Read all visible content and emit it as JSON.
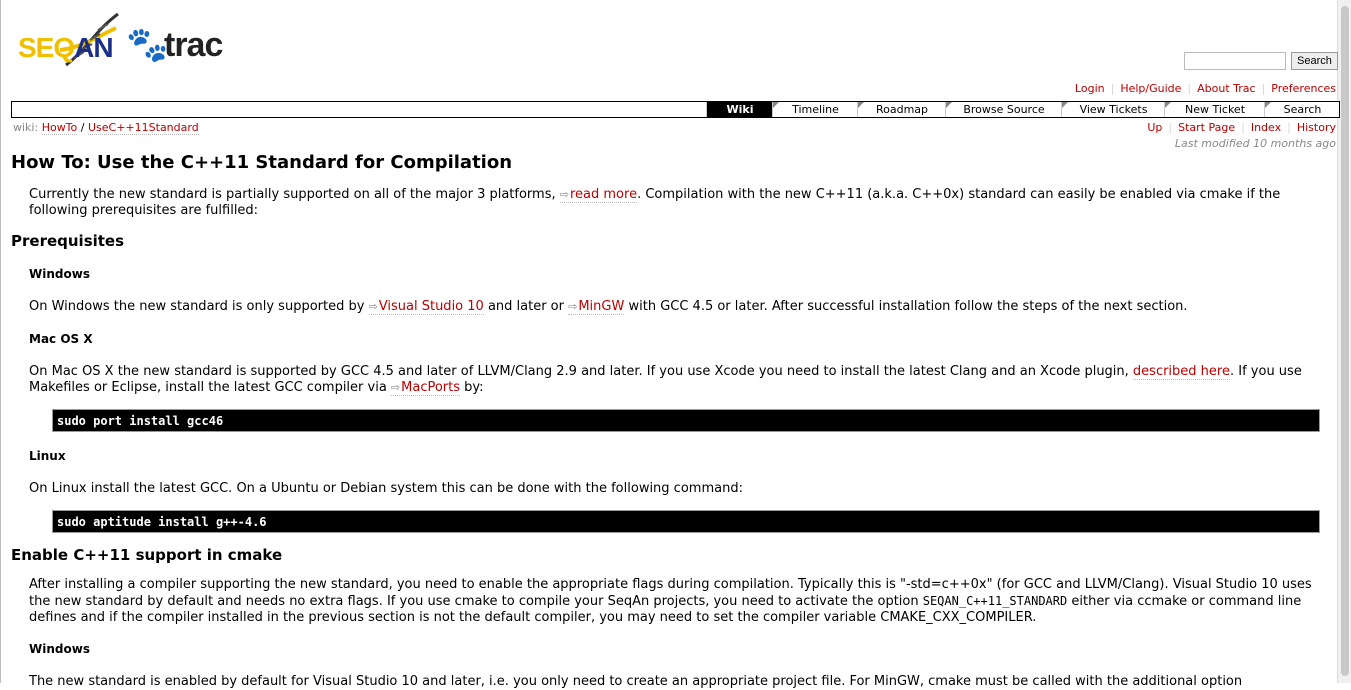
{
  "logo": {
    "seq": "SEQ",
    "an": "AN",
    "trac": "trac",
    "paw": "🐾"
  },
  "search": {
    "placeholder": "",
    "button_label": "Search"
  },
  "metanav": [
    "Login",
    "Help/Guide",
    "About Trac",
    "Preferences"
  ],
  "mainnav": [
    "Wiki",
    "Timeline",
    "Roadmap",
    "Browse Source",
    "View Tickets",
    "New Ticket",
    "Search"
  ],
  "breadcrumb": {
    "label": "wiki:",
    "part1": "HowTo",
    "sep": "/",
    "part2": "UseC++11Standard"
  },
  "ctxnav": [
    "Up",
    "Start Page",
    "Index",
    "History"
  ],
  "last_modified": "Last modified 10 months ago",
  "page": {
    "title": "How To: Use the C++11 Standard for Compilation",
    "intro_a": "Currently the new standard is partially supported on all of the major 3 platforms, ",
    "intro_link": "read more",
    "intro_b": ". Compilation with the new C++11 (a.k.a. C++0x) standard can easily be enabled via cmake if the following prerequisites are fulfilled:",
    "h_prereq": "Prerequisites",
    "h_windows": "Windows",
    "win_a": "On Windows the new standard is only supported by ",
    "win_link1": "Visual Studio 10",
    "win_b": " and later or ",
    "win_link2": "MinGW",
    "win_c": " with GCC 4.5 or later. After successful installation follow the steps of the next section.",
    "h_mac": "Mac OS X",
    "mac_a": "On Mac OS X the new standard is supported by GCC 4.5 and later of LLVM/Clang 2.9 and later. If you use Xcode you need to install the latest Clang and an Xcode plugin, ",
    "mac_link1": "described here",
    "mac_b": ". If you use Makefiles or Eclipse, install the latest GCC compiler via ",
    "mac_link2": "MacPorts",
    "mac_c": " by:",
    "code_mac": "sudo port install gcc46",
    "h_linux": "Linux",
    "linux_text": "On Linux install the latest GCC. On a Ubuntu or Debian system this can be done with the following command:",
    "code_linux": "sudo aptitude install g++-4.6",
    "h_enable": "Enable C++11 support in cmake",
    "enable_a": "After installing a compiler supporting the new standard, you need to enable the appropriate flags during compilation. Typically this is \"-std=c++0x\" (for GCC and LLVM/Clang). Visual Studio 10 uses the new standard by default and needs no extra flags. If you use cmake to compile your SeqAn projects, you need to activate the option ",
    "enable_code": "SEQAN_C++11_STANDARD",
    "enable_b": " either via ccmake or command line defines and if the compiler installed in the previous section is not the default compiler, you may need to set the compiler variable CMAKE_CXX_COMPILER.",
    "h_windows2": "Windows",
    "win2_text": "The new standard is enabled by default for Visual Studio 10 and later, i.e. you only need to create an appropriate project file. For MinGW, cmake must be called with the additional option"
  },
  "ext_icon": "⇨"
}
